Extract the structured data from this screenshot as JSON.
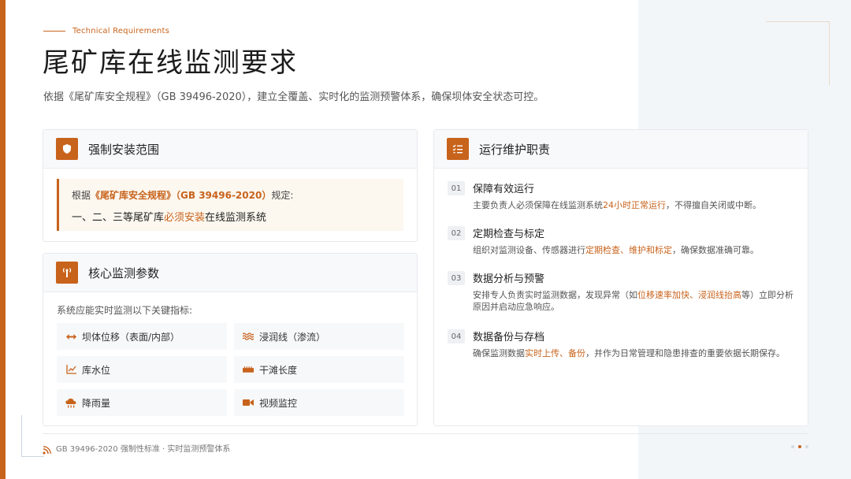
{
  "header": {
    "kicker": "Technical Requirements",
    "title": "尾矿库在线监测要求",
    "subtitle": "依据《尾矿库安全规程》（GB 39496-2020），建立全覆盖、实时化的监测预警体系，确保坝体安全状态可控。"
  },
  "install_card": {
    "title": "强制安装范围",
    "icon": "shield-icon",
    "line1_prefix": "根据",
    "line1_highlight": "《尾矿库安全规程》（GB 39496-2020）",
    "line1_suffix": "规定:",
    "line2_prefix": "一、二、三等尾矿库",
    "line2_highlight": "必须安装",
    "line2_suffix": "在线监测系统"
  },
  "monitor_card": {
    "title": "核心监测参数",
    "icon": "antenna-icon",
    "intro": "系统应能实时监测以下关键指标:",
    "params": [
      {
        "label": "坝体位移（表面/内部）",
        "icon": "arrows-horizontal-icon"
      },
      {
        "label": "浸润线（渗流）",
        "icon": "water-waves-icon"
      },
      {
        "label": "库水位",
        "icon": "line-chart-icon"
      },
      {
        "label": "干滩长度",
        "icon": "ruler-icon"
      },
      {
        "label": "降雨量",
        "icon": "rain-cloud-icon"
      },
      {
        "label": "视频监控",
        "icon": "video-camera-icon"
      }
    ]
  },
  "ops_card": {
    "title": "运行维护职责",
    "icon": "task-list-icon",
    "items": [
      {
        "num": "01",
        "title": "保障有效运行",
        "desc_prefix": "主要负责人必须保障在线监测系统",
        "desc_highlight": "24小时正常运行",
        "desc_suffix": "，不得擅自关闭或中断。"
      },
      {
        "num": "02",
        "title": "定期检查与标定",
        "desc_prefix": "组织对监测设备、传感器进行",
        "desc_highlight": "定期检查、维护和标定",
        "desc_suffix": "，确保数据准确可靠。"
      },
      {
        "num": "03",
        "title": "数据分析与预警",
        "desc_prefix": "安排专人负责实时监测数据，发现异常（如",
        "desc_highlight": "位移速率加快、浸润线抬高",
        "desc_suffix": "等）立即分析原因并启动应急响应。"
      },
      {
        "num": "04",
        "title": "数据备份与存档",
        "desc_prefix": "确保监测数据",
        "desc_highlight": "实时上传、备份",
        "desc_suffix": "，并作为日常管理和隐患排查的重要依据长期保存。"
      }
    ]
  },
  "footer": {
    "text": "GB 39496-2020 强制性标准 · 实时监测预警体系",
    "icon": "satellite-dish-icon",
    "page_dots": {
      "total": 3,
      "active_index": 1
    }
  },
  "colors": {
    "accent": "#c8631c",
    "right_panel": "#f3f6f9",
    "text": "#222222"
  }
}
